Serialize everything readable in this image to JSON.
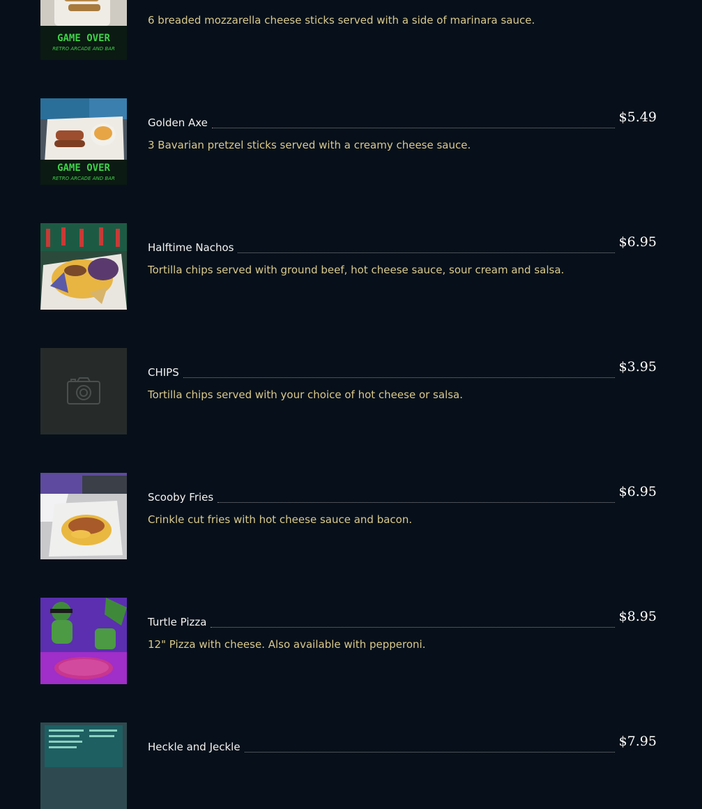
{
  "colors": {
    "background": "#07101a",
    "item_name": "#f2f2f2",
    "description": "#d9c98c",
    "price": "#ffffff",
    "leader": "#8c8c8c"
  },
  "menu": {
    "items": [
      {
        "name": "",
        "price": "",
        "description": "6 breaded mozzarella cheese sticks served with a side of marinara sauce.",
        "image": "game-over-mat-photo",
        "image_text": "GAME OVER",
        "image_subtext": "RETRO ARCADE AND BAR"
      },
      {
        "name": "Golden Axe",
        "price": "$5.49",
        "description": "3 Bavarian pretzel sticks served with a creamy cheese sauce.",
        "image": "pretzel-sticks-photo",
        "image_text": "GAME OVER",
        "image_subtext": "RETRO ARCADE AND BAR"
      },
      {
        "name": "Halftime Nachos",
        "price": "$6.95",
        "description": "Tortilla chips served with ground beef, hot cheese sauce, sour cream and salsa.",
        "image": "nachos-photo"
      },
      {
        "name": "CHIPS",
        "price": "$3.95",
        "description": "Tortilla chips served with your choice of hot cheese or salsa.",
        "image": "camera-icon"
      },
      {
        "name": "Scooby Fries",
        "price": "$6.95",
        "description": "Crinkle cut fries with hot cheese sauce and bacon.",
        "image": "cheese-fries-photo"
      },
      {
        "name": "Turtle Pizza",
        "price": "$8.95",
        "description": "12\" Pizza with cheese. Also available with pepperoni.",
        "image": "pizza-photo"
      },
      {
        "name": "Heckle and Jeckle",
        "price": "$7.95",
        "description": "",
        "image": "menu-board-photo"
      }
    ]
  }
}
